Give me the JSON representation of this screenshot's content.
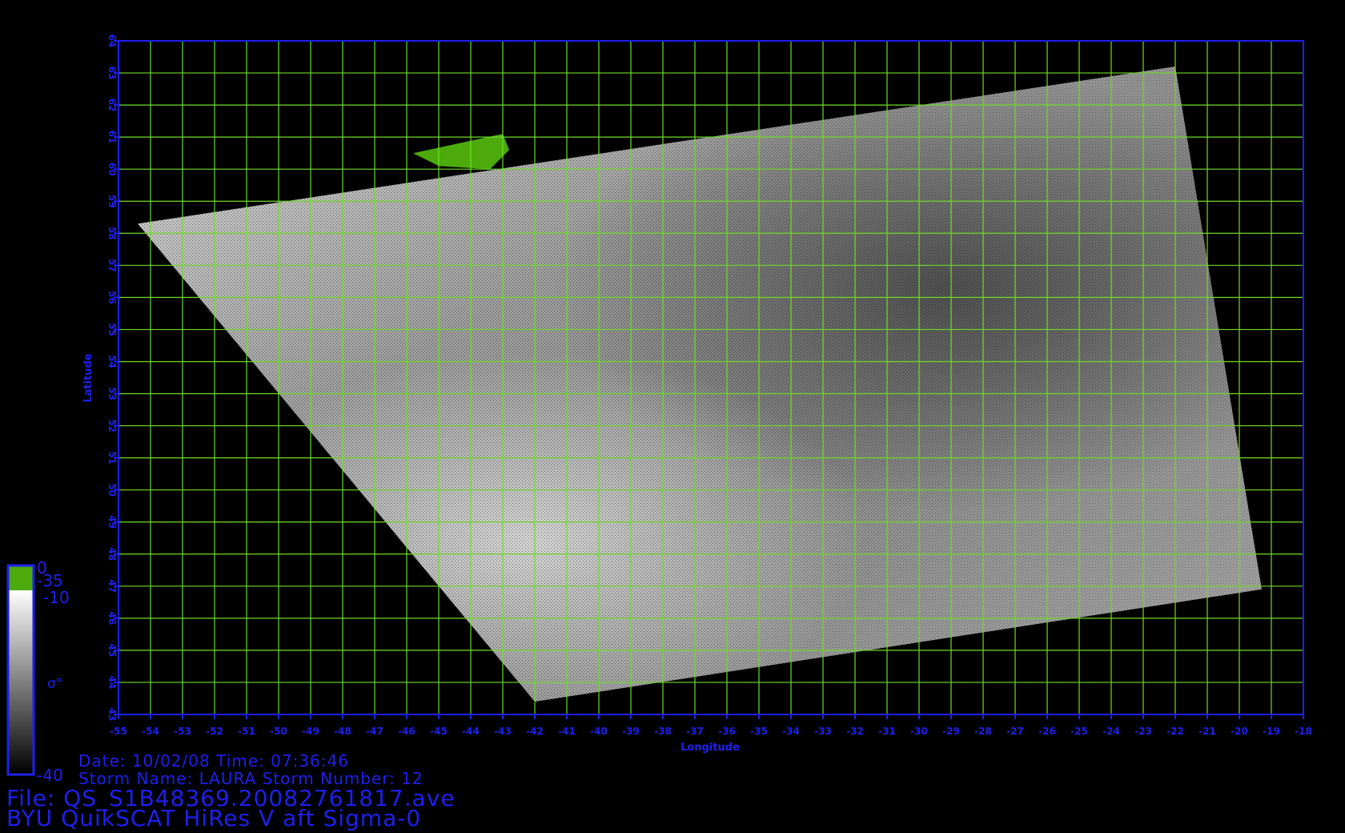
{
  "map": {
    "xlabel": "Longitude",
    "ylabel": "Latitude",
    "lon_range": [
      -55,
      -18
    ],
    "lat_range": [
      43,
      64
    ],
    "lon_ticks": [
      "-55",
      "-54",
      "-53",
      "-52",
      "-51",
      "-50",
      "-49",
      "-48",
      "-47",
      "-46",
      "-45",
      "-44",
      "-43",
      "-42",
      "-41",
      "-40",
      "-39",
      "-38",
      "-37",
      "-36",
      "-35",
      "-34",
      "-33",
      "-32",
      "-31",
      "-30",
      "-29",
      "-28",
      "-27",
      "-26",
      "-25",
      "-24",
      "-23",
      "-22",
      "-21",
      "-20",
      "-19",
      "-18"
    ],
    "lat_ticks": [
      "43",
      "44",
      "45",
      "46",
      "47",
      "48",
      "49",
      "50",
      "51",
      "52",
      "53",
      "54",
      "55",
      "56",
      "57",
      "58",
      "59",
      "60",
      "61",
      "62",
      "63",
      "64"
    ],
    "grid_interval_deg": 1,
    "grid": true,
    "colors": {
      "axis": "#1f1ff0",
      "grid": "#6fdc2a",
      "land": "#4caa0c",
      "background": "#000000"
    },
    "swath_corners_lonlat": [
      [
        -54.4,
        58.3
      ],
      [
        -22.0,
        63.2
      ],
      [
        -19.3,
        46.9
      ],
      [
        -42.0,
        43.4
      ]
    ],
    "land_region_lonlat": [
      [
        -45.8,
        60.5
      ],
      [
        -43.0,
        61.1
      ],
      [
        -42.8,
        60.6
      ],
      [
        -43.4,
        60.0
      ],
      [
        -45.0,
        60.1
      ]
    ]
  },
  "colorbar": {
    "label": "σ°",
    "land_top": "0",
    "land_bottom": "-35",
    "scale_top": "-10",
    "scale_bottom": "-40",
    "land_color": "#4caa0c",
    "gradient": [
      "#ffffff",
      "#000000"
    ]
  },
  "info": {
    "date_line": "Date: 10/02/08   Time: 07:36:46",
    "storm_line": "Storm  Name: LAURA   Storm  Number: 12",
    "file_line": "File: QS_S1B48369.20082761817.ave",
    "product_line": "BYU  QuikSCAT  HiRes  V  aft  Sigma-0"
  }
}
